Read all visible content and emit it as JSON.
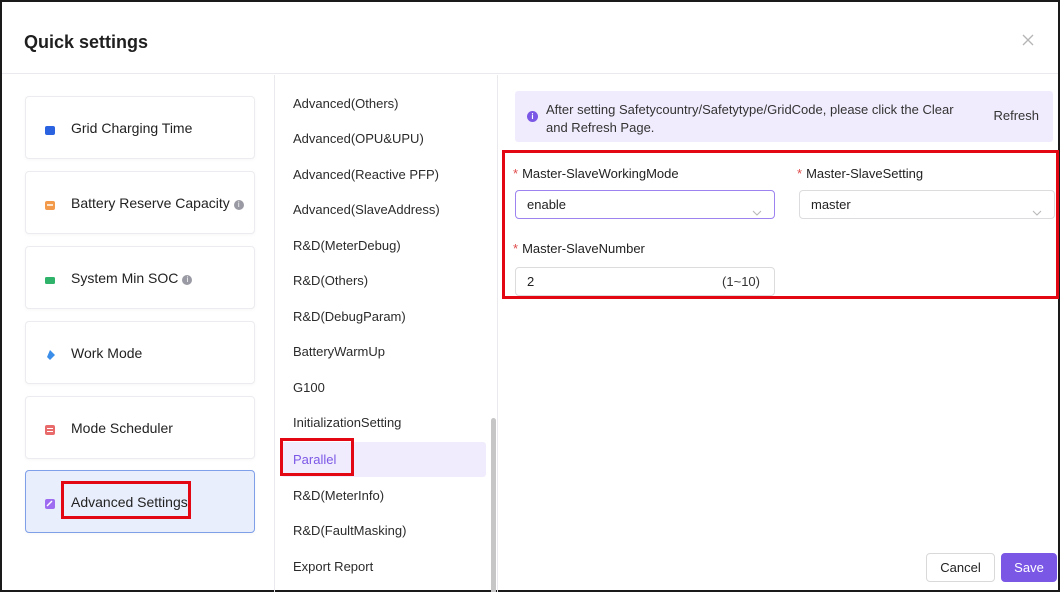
{
  "dialog": {
    "title": "Quick settings"
  },
  "left_cards": [
    {
      "label": "Grid Charging Time",
      "icon": "calendar-blue-icon",
      "color": "#2a62e0",
      "info": false
    },
    {
      "label": "Battery Reserve Capacity",
      "icon": "battery-orange-icon",
      "color": "#f29a4a",
      "info": true
    },
    {
      "label": "System Min SOC",
      "icon": "battery-green-icon",
      "color": "#2fb36a",
      "info": true
    },
    {
      "label": "Work Mode",
      "icon": "work-mode-icon",
      "color": "#3a8de8",
      "info": false
    },
    {
      "label": "Mode Scheduler",
      "icon": "scheduler-icon",
      "color": "#e86a6a",
      "info": false
    },
    {
      "label": "Advanced Settings",
      "icon": "advanced-settings-icon",
      "color": "#9d6cf0",
      "info": false,
      "active": true
    }
  ],
  "menu": {
    "items": [
      "Advanced(Others)",
      "Advanced(OPU&UPU)",
      "Advanced(Reactive PFP)",
      "Advanced(SlaveAddress)",
      "R&D(MeterDebug)",
      "R&D(Others)",
      "R&D(DebugParam)",
      "BatteryWarmUp",
      "G100",
      "InitializationSetting",
      "Parallel",
      "R&D(MeterInfo)",
      "R&D(FaultMasking)",
      "Export Report"
    ],
    "active": "Parallel"
  },
  "notice": {
    "text": "After setting Safetycountry/Safetytype/GridCode, please click the Clear and Refresh Page.",
    "refresh_label": "Refresh"
  },
  "form": {
    "working_mode": {
      "label": "Master-SlaveWorkingMode",
      "value": "enable"
    },
    "setting": {
      "label": "Master-SlaveSetting",
      "value": "master"
    },
    "number": {
      "label": "Master-SlaveNumber",
      "value": "2",
      "range": "(1~10)"
    }
  },
  "buttons": {
    "cancel": "Cancel",
    "save": "Save"
  },
  "colors": {
    "accent": "#7b57e6",
    "highlight": "#e30613",
    "active_card_bg": "#e8eefc"
  }
}
